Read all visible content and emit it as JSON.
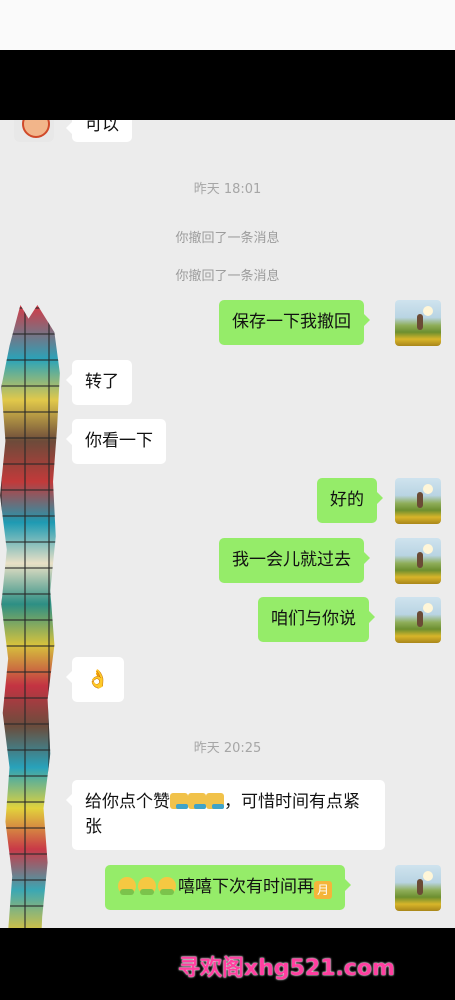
{
  "timestamps": {
    "first": "昨天 18:01",
    "second": "昨天 20:25"
  },
  "system": {
    "recall_1": "你撤回了一条消息",
    "recall_2": "你撤回了一条消息"
  },
  "messages": {
    "top_partial": "可以",
    "m1": "保存一下我撤回",
    "m2": "转了",
    "m3": "你看一下",
    "m4": "好的",
    "m5": "我一会儿就过去",
    "m6": "咱们与你说",
    "m7_emoji": "👌",
    "m8_part1": "给你点个赞",
    "m8_part2": "，可惜时间有点紧张",
    "m9_text": "嘻嘻下次有时间再",
    "m9_badge": "月"
  },
  "watermark": "寻欢阁xhg521.com",
  "colors": {
    "out_bubble": "#95ec69",
    "in_bubble": "#ffffff",
    "chat_bg": "#ececec",
    "watermark": "#ff3fa0"
  },
  "icons": {
    "ok": "ok-hand-icon",
    "thumb": "thumbs-up-icon",
    "chick": "chick-emoji-icon"
  }
}
